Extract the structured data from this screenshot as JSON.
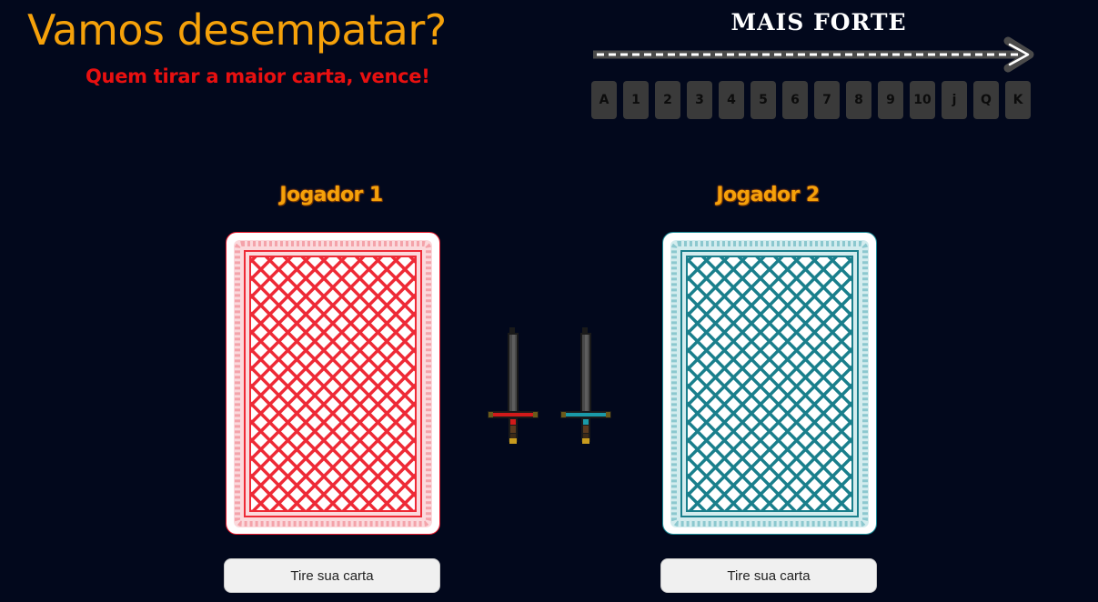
{
  "header": {
    "title": "Vamos desempatar?",
    "subtitle": "Quem tirar a maior carta, vence!"
  },
  "strength_scale": {
    "label": "MAIS FORTE",
    "ranks": [
      "A",
      "1",
      "2",
      "3",
      "4",
      "5",
      "6",
      "7",
      "8",
      "9",
      "10",
      "j",
      "Q",
      "K"
    ]
  },
  "players": [
    {
      "name": "Jogador 1",
      "card_color": "#e8192c",
      "button_label": "Tire sua carta",
      "sword_icon": "sword-red-icon"
    },
    {
      "name": "Jogador 2",
      "card_color": "#1a8a96",
      "button_label": "Tire sua carta",
      "sword_icon": "sword-teal-icon"
    }
  ],
  "colors": {
    "background": "#02081c",
    "title": "#f5a10a",
    "subtitle": "#e81010"
  }
}
